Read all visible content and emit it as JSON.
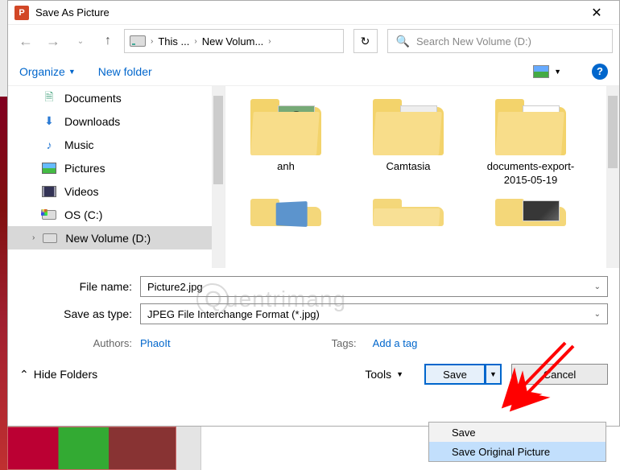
{
  "titlebar": {
    "app_icon_text": "P",
    "title": "Save As Picture"
  },
  "nav": {
    "breadcrumb": {
      "level1": "This ...",
      "level2": "New Volum..."
    },
    "search_placeholder": "Search New Volume (D:)"
  },
  "toolbar": {
    "organize": "Organize",
    "new_folder": "New folder",
    "help_glyph": "?"
  },
  "sidebar": {
    "items": [
      {
        "label": "Documents",
        "icon": "doc"
      },
      {
        "label": "Downloads",
        "icon": "dl"
      },
      {
        "label": "Music",
        "icon": "music"
      },
      {
        "label": "Pictures",
        "icon": "pic"
      },
      {
        "label": "Videos",
        "icon": "vid"
      },
      {
        "label": "OS (C:)",
        "icon": "drive-c"
      },
      {
        "label": "New Volume (D:)",
        "icon": "drive",
        "selected": true
      }
    ]
  },
  "content": {
    "folders": [
      {
        "label": "anh",
        "thumb": "panda"
      },
      {
        "label": "Camtasia",
        "thumb": "gray"
      },
      {
        "label": "documents-export-2015-05-19",
        "thumb": "doc"
      }
    ]
  },
  "form": {
    "filename_label": "File name:",
    "filename_value": "Picture2.jpg",
    "savetype_label": "Save as type:",
    "savetype_value": "JPEG File Interchange Format (*.jpg)",
    "authors_label": "Authors:",
    "authors_value": "PhaoIt",
    "tags_label": "Tags:",
    "tags_value": "Add a tag"
  },
  "footer": {
    "hide_folders": "Hide Folders",
    "tools": "Tools",
    "save": "Save",
    "cancel": "Cancel"
  },
  "dropdown": {
    "items": [
      {
        "label": "Save"
      },
      {
        "label": "Save Original Picture",
        "hover": true
      }
    ]
  },
  "watermark": "uentrimang"
}
